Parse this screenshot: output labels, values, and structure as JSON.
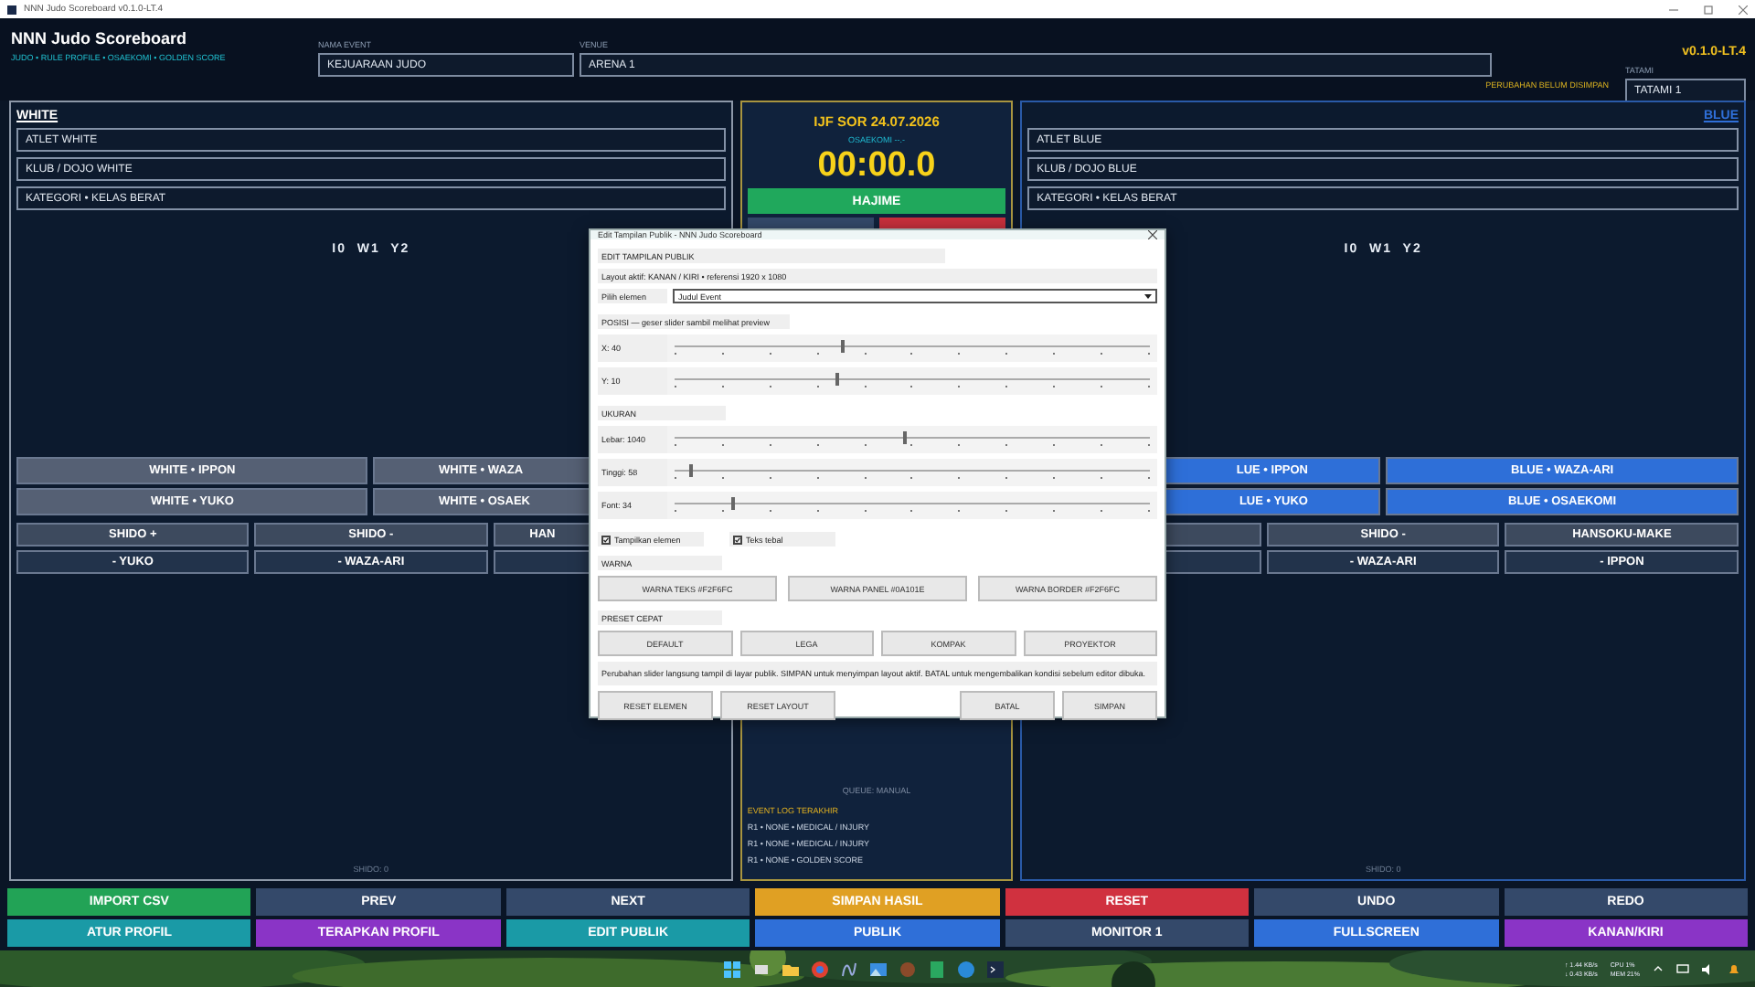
{
  "window": {
    "title": "NNN Judo Scoreboard v0.1.0-LT.4"
  },
  "header": {
    "app_title": "NNN Judo Scoreboard",
    "subtitle": "JUDO • RULE PROFILE • OSAEKOMI • GOLDEN SCORE",
    "event_label": "NAMA EVENT",
    "event_value": "KEJUARAAN JUDO",
    "venue_label": "VENUE",
    "venue_value": "ARENA 1",
    "version": "v0.1.0-LT.4",
    "unsaved_notice": "PERUBAHAN BELUM DISIMPAN",
    "tatami_label": "TATAMI",
    "tatami_value": "TATAMI 1"
  },
  "panels": [
    {
      "kind": "white",
      "title": "WHITE",
      "fields": [
        "ATLET WHITE",
        "KLUB / DOJO WHITE",
        "KATEGORI • KELAS BERAT"
      ],
      "score": "I0  W1  Y2",
      "footer": "SHIDO: 0",
      "button_rows": [
        [
          "WHITE • IPPON",
          "WHITE • WAZA"
        ],
        [
          "WHITE • YUKO",
          "WHITE • OSAEK"
        ],
        [
          "SHIDO +",
          "SHIDO -",
          "HAN"
        ],
        [
          "- YUKO",
          "- WAZA-ARI",
          null
        ]
      ]
    },
    {
      "kind": "blue",
      "title": "BLUE",
      "fields": [
        "ATLET BLUE",
        "KLUB / DOJO BLUE",
        "KATEGORI • KELAS BERAT"
      ],
      "score": "I0  W1  Y2",
      "footer": "SHIDO: 0",
      "button_rows": [
        [
          "LUE • IPPON",
          "BLUE • WAZA-ARI"
        ],
        [
          "LUE • YUKO",
          "BLUE • OSAEKOMI"
        ],
        [
          null,
          "SHIDO -",
          "HANSOKU-MAKE"
        ],
        [
          null,
          "- WAZA-ARI",
          "- IPPON"
        ]
      ]
    }
  ],
  "center": {
    "rule": "IJF SOR 24.07.2026",
    "osaekomi": "OSAEKOMI --.-",
    "clock": "00:00.0",
    "hajime": "HAJIME",
    "queue": "QUEUE: MANUAL",
    "log_title": "EVENT LOG TERAKHIR",
    "log": [
      "R1 • NONE • MEDICAL / INJURY",
      "R1 • NONE • MEDICAL / INJURY",
      "R1 • NONE • GOLDEN SCORE"
    ]
  },
  "dialog": {
    "title": "Edit Tampilan Publik - NNN Judo Scoreboard",
    "heading": "EDIT TAMPILAN PUBLIK",
    "layout_info": "Layout aktif: KANAN / KIRI • referensi 1920 x 1080",
    "element_label": "Pilih elemen",
    "element_value": "Judul Event",
    "sections": [
      {
        "title": "POSISI — geser slider sambil melihat preview",
        "sliders": [
          {
            "label": "X: 40",
            "level": 0.35
          },
          {
            "label": "Y: 10",
            "level": 0.34
          }
        ]
      },
      {
        "title": "UKURAN",
        "sliders": [
          {
            "label": "Lebar: 1040",
            "level": 0.48
          },
          {
            "label": "Tinggi: 58",
            "level": 0.03
          },
          {
            "label": "Font: 34",
            "level": 0.12
          }
        ]
      }
    ],
    "checkboxes": [
      {
        "label": "Tampilkan elemen",
        "checked": true
      },
      {
        "label": "Teks tebal",
        "checked": true
      }
    ],
    "color_title": "WARNA",
    "color_buttons": [
      "WARNA TEKS #F2F6FC",
      "WARNA PANEL #0A101E",
      "WARNA BORDER #F2F6FC"
    ],
    "preset_title": "PRESET CEPAT",
    "preset_buttons": [
      "DEFAULT",
      "LEGA",
      "KOMPAK",
      "PROYEKTOR"
    ],
    "note": "Perubahan slider langsung tampil di layar publik. SIMPAN untuk menyimpan layout aktif. BATAL untuk mengembalikan kondisi sebelum editor dibuka.",
    "left_buttons": [
      "RESET ELEMEN",
      "RESET LAYOUT"
    ],
    "right_buttons": [
      "BATAL",
      "SIMPAN"
    ]
  },
  "actions": [
    [
      {
        "label": "IMPORT CSV",
        "color": "#22a356"
      },
      {
        "label": "PREV",
        "color": "#34496a"
      },
      {
        "label": "NEXT",
        "color": "#34496a"
      },
      {
        "label": "SIMPAN HASIL",
        "color": "#e0a023"
      },
      {
        "label": "RESET",
        "color": "#d0313f"
      },
      {
        "label": "UNDO",
        "color": "#34496a"
      },
      {
        "label": "REDO",
        "color": "#34496a"
      }
    ],
    [
      {
        "label": "ATUR PROFIL",
        "color": "#1a9aa6"
      },
      {
        "label": "TERAPKAN PROFIL",
        "color": "#8a34c6"
      },
      {
        "label": "EDIT PUBLIK",
        "color": "#1a9aa6"
      },
      {
        "label": "PUBLIK",
        "color": "#2f6fd8"
      },
      {
        "label": "MONITOR 1",
        "color": "#34496a"
      },
      {
        "label": "FULLSCREEN",
        "color": "#2f6fd8"
      },
      {
        "label": "KANAN/KIRI",
        "color": "#8a34c6"
      }
    ]
  ],
  "taskbar": {
    "upload": "↑ 1.44 KB/s",
    "download": "↓ 0.43 KB/s",
    "cpu": "CPU 1%",
    "mem": "MEM 21%"
  }
}
